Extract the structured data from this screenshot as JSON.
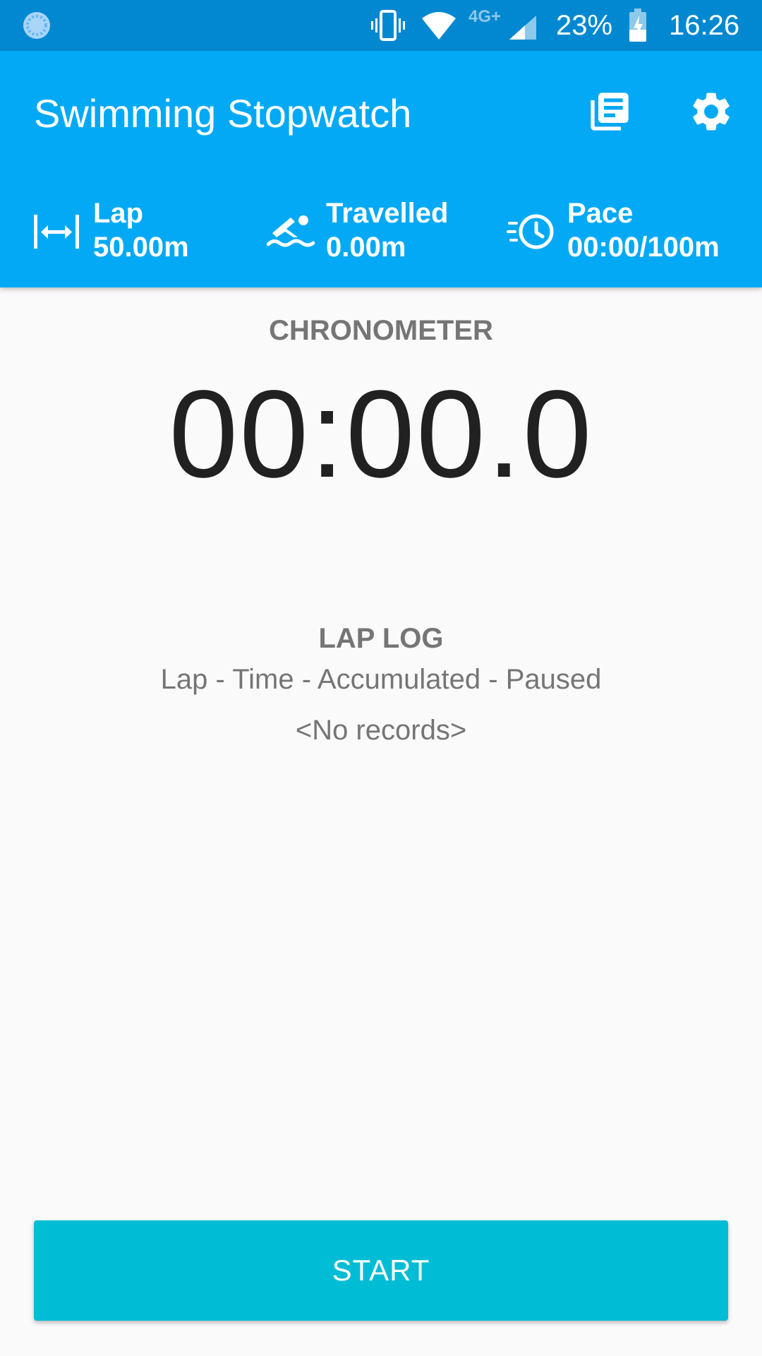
{
  "status_bar": {
    "network": "4G+",
    "battery_percent": "23%",
    "time": "16:26",
    "icons": [
      "app-notification-icon",
      "vibrate-icon",
      "wifi-icon",
      "signal-icon",
      "battery-charging-icon"
    ]
  },
  "app_bar": {
    "title": "Swimming Stopwatch",
    "actions": [
      "lap-log-icon",
      "settings-icon"
    ],
    "stats": {
      "lap": {
        "label": "Lap",
        "value": "50.00m"
      },
      "travelled": {
        "label": "Travelled",
        "value": "0.00m"
      },
      "pace": {
        "label": "Pace",
        "value": "00:00/100m"
      }
    }
  },
  "chronometer": {
    "label": "CHRONOMETER",
    "time": "00:00.0"
  },
  "lap_log": {
    "label": "LAP LOG",
    "columns": "Lap - Time - Accumulated - Paused",
    "empty_text": "<No records>"
  },
  "start_button": {
    "label": "START"
  },
  "colors": {
    "status_bar": "#0288d1",
    "primary": "#03a9f4",
    "accent": "#00bcd4",
    "background": "#fafafa",
    "secondary_text": "#757575"
  }
}
